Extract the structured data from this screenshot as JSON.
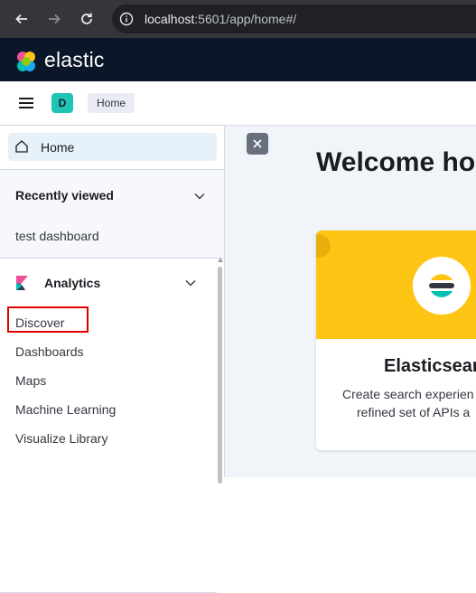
{
  "browser": {
    "url_host": "localhost",
    "url_path": ":5601/app/home#/"
  },
  "header": {
    "brand": "elastic"
  },
  "breadcrumbs": {
    "space_initial": "D",
    "items": [
      "Home"
    ]
  },
  "sidenav": {
    "home_label": "Home",
    "recently_viewed": {
      "title": "Recently viewed",
      "items": [
        "test dashboard"
      ]
    },
    "analytics": {
      "title": "Analytics",
      "items": [
        "Discover",
        "Dashboards",
        "Maps",
        "Machine Learning",
        "Visualize Library"
      ]
    }
  },
  "main": {
    "welcome_title": "Welcome ho",
    "card": {
      "title": "Elasticsear",
      "description_line1": "Create search experien",
      "description_line2": "refined set of APIs a"
    }
  },
  "colors": {
    "header_bg": "#0b1628",
    "space_avatar": "#20c4b7",
    "card_banner": "#fec514",
    "highlight": "#e00000"
  }
}
